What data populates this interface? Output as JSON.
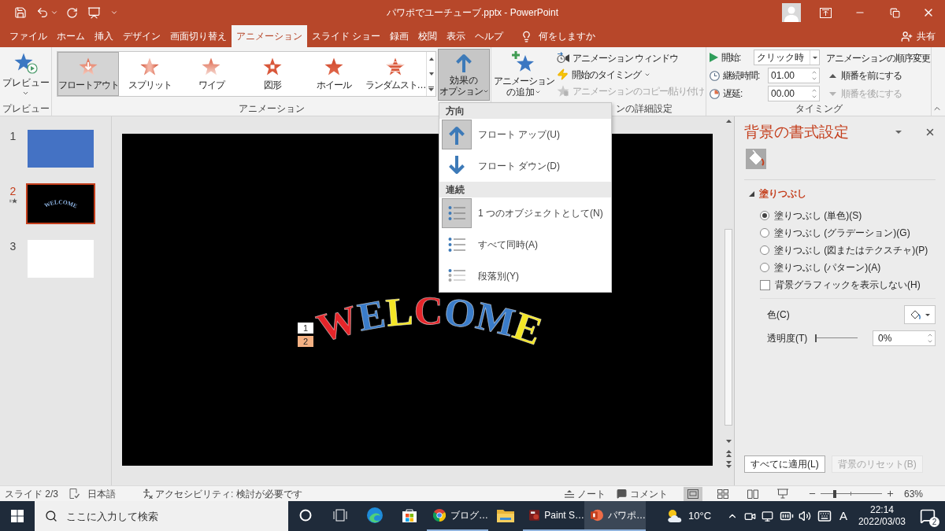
{
  "title_bar": {
    "title": "パワポでユーチューブ.pptx - PowerPoint"
  },
  "tabs": [
    {
      "label": "ファイル",
      "selected": false
    },
    {
      "label": "ホーム",
      "selected": false
    },
    {
      "label": "挿入",
      "selected": false
    },
    {
      "label": "デザイン",
      "selected": false
    },
    {
      "label": "画面切り替え",
      "selected": false
    },
    {
      "label": "アニメーション",
      "selected": true
    },
    {
      "label": "スライド ショー",
      "selected": false
    },
    {
      "label": "録画",
      "selected": false
    },
    {
      "label": "校閲",
      "selected": false
    },
    {
      "label": "表示",
      "selected": false
    },
    {
      "label": "ヘルプ",
      "selected": false
    }
  ],
  "tell_me": "何をしますか",
  "share": "共有",
  "ribbon": {
    "preview": {
      "button": "プレビュー",
      "group_label": "プレビュー"
    },
    "animation_gallery": {
      "items": [
        {
          "label": "フロートアウト",
          "selected": true
        },
        {
          "label": "スプリット",
          "selected": false
        },
        {
          "label": "ワイプ",
          "selected": false
        },
        {
          "label": "図形",
          "selected": false
        },
        {
          "label": "ホイール",
          "selected": false
        },
        {
          "label": "ランダムスト…",
          "selected": false
        }
      ],
      "group_label": "アニメーション"
    },
    "effect_options": {
      "lines": [
        "効果の",
        "オプション"
      ],
      "pressed": true
    },
    "advanced": {
      "add_animation": [
        "アニメーション",
        "の追加"
      ],
      "commands": [
        {
          "label": "アニメーション ウィンドウ",
          "disabled": false,
          "has_menu": false
        },
        {
          "label": "開始のタイミング",
          "disabled": false,
          "has_menu": true
        },
        {
          "label": "アニメーションのコピー/貼り付け",
          "disabled": true,
          "has_menu": false
        }
      ],
      "group_label": "ンの詳細設定"
    },
    "timing": {
      "fields": [
        {
          "kind": "dropdown",
          "label": "開始:",
          "value": "クリック時"
        },
        {
          "kind": "spinner",
          "label": "継続時間:",
          "value": "01.00"
        },
        {
          "kind": "spinner",
          "label": "遅延:",
          "value": "00.00"
        }
      ],
      "reorder_title": "アニメーションの順序変更",
      "reorder": [
        {
          "label": "順番を前にする",
          "disabled": false
        },
        {
          "label": "順番を後にする",
          "disabled": true
        }
      ],
      "group_label": "タイミング"
    }
  },
  "effect_menu": {
    "sections": [
      {
        "header": "方向",
        "items": [
          {
            "label": "フロート アップ(U)",
            "selected": true
          },
          {
            "label": "フロート ダウン(D)",
            "selected": false
          }
        ]
      },
      {
        "header": "連続",
        "items": [
          {
            "label": "1 つのオブジェクトとして(N)",
            "selected": true
          },
          {
            "label": "すべて同時(A)",
            "selected": false
          },
          {
            "label": "段落別(Y)",
            "selected": false
          }
        ]
      }
    ]
  },
  "slides": [
    {
      "number": "1",
      "selected": false,
      "animated": false,
      "color": "#4472c4"
    },
    {
      "number": "2",
      "selected": true,
      "animated": true,
      "color": "#000000",
      "text": "WELCOME"
    },
    {
      "number": "3",
      "selected": false,
      "animated": false,
      "color": "#ffffff"
    }
  ],
  "slide": {
    "wordart": "WELCOME",
    "animation_tags": [
      {
        "number": "1",
        "selected": false
      },
      {
        "number": "2",
        "selected": true
      }
    ]
  },
  "format_pane": {
    "title": "背景の書式設定",
    "section": {
      "title": "塗りつぶし",
      "expanded": true
    },
    "fill_options": [
      {
        "label": "塗りつぶし (単色)(S)",
        "selected": true
      },
      {
        "label": "塗りつぶし (グラデーション)(G)",
        "selected": false
      },
      {
        "label": "塗りつぶし (図またはテクスチャ)(P)",
        "selected": false
      },
      {
        "label": "塗りつぶし (パターン)(A)",
        "selected": false
      }
    ],
    "hide_background_graphics": {
      "label": "背景グラフィックを表示しない(H)",
      "checked": false
    },
    "color": {
      "label": "色(C)"
    },
    "transparency": {
      "label": "透明度(T)",
      "level": 0,
      "value": "0%"
    },
    "buttons": [
      {
        "label": "すべてに適用(L)",
        "disabled": false
      },
      {
        "label": "背景のリセット(B)",
        "disabled": true
      }
    ]
  },
  "status_bar": {
    "slide": "スライド 2/3",
    "language": "日本語",
    "accessibility": "アクセシビリティ: 検討が必要です",
    "notes": "ノート",
    "comments": "コメント",
    "views": [
      {
        "selected": true
      },
      {
        "selected": false
      },
      {
        "selected": false
      },
      {
        "selected": false
      }
    ],
    "zoom": {
      "level": 0.22,
      "value": "63%"
    }
  },
  "taskbar": {
    "search_placeholder": "ここに入力して検索",
    "apps": [
      {
        "kind": "cortana",
        "running": false,
        "active": false
      },
      {
        "kind": "task_view",
        "running": false,
        "active": false
      },
      {
        "kind": "edge",
        "running": false,
        "active": false
      },
      {
        "kind": "store",
        "running": false,
        "active": false
      },
      {
        "kind": "chrome",
        "label": "ブログ…",
        "running": true,
        "active": false
      },
      {
        "kind": "explorer",
        "running": false,
        "active": false
      },
      {
        "kind": "paintshop",
        "label": "Paint S…",
        "running": true,
        "active": false
      },
      {
        "kind": "powerpoint",
        "label": "パワポ…",
        "running": true,
        "active": true
      }
    ],
    "weather": "10°C",
    "ime": "A",
    "time": "22:14",
    "date": "2022/03/03",
    "notifications": "2"
  }
}
